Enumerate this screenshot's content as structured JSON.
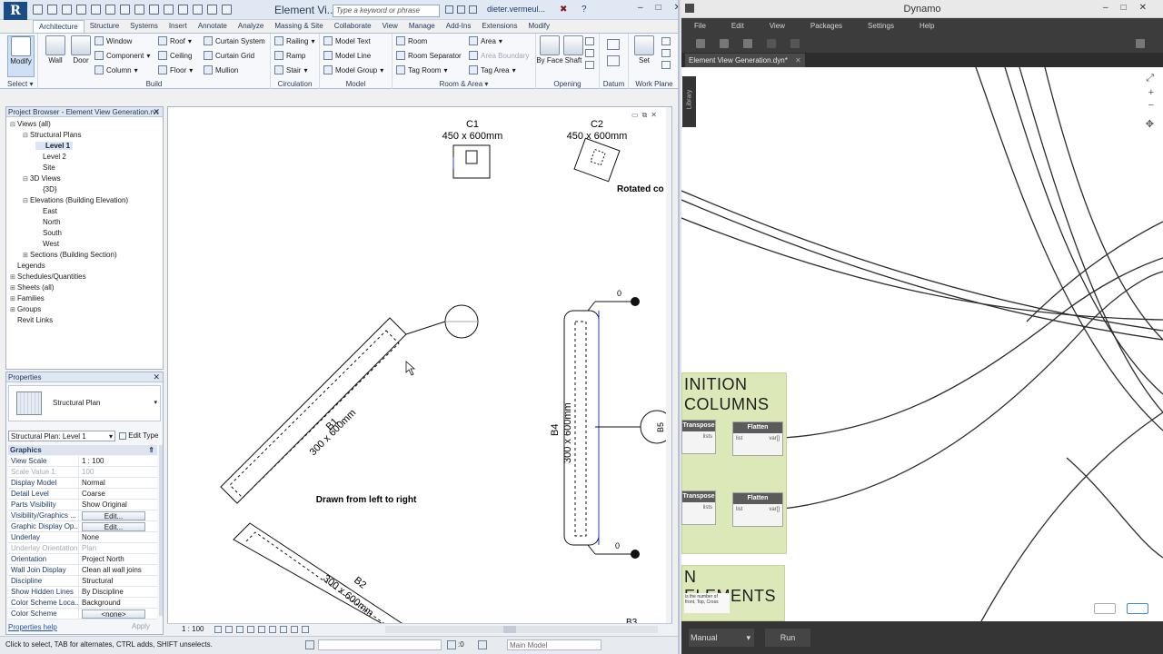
{
  "revit": {
    "title": "Element Vi...",
    "search_placeholder": "Type a keyword or phrase",
    "user": "dieter.vermeul...",
    "window_controls": [
      "–",
      "□",
      "✕"
    ],
    "tabs": [
      "Architecture",
      "Structure",
      "Systems",
      "Insert",
      "Annotate",
      "Analyze",
      "Massing & Site",
      "Collaborate",
      "View",
      "Manage",
      "Add-Ins",
      "Extensions",
      "Modify"
    ],
    "active_tab": "Architecture",
    "ribbon": {
      "modify": "Modify",
      "select": "Select",
      "wall": "Wall",
      "door": "Door",
      "window": "Window",
      "component": "Component",
      "column": "Column",
      "roof": "Roof",
      "ceiling": "Ceiling",
      "floor": "Floor",
      "curtain_system": "Curtain System",
      "curtain_grid": "Curtain Grid",
      "mullion": "Mullion",
      "railing": "Railing",
      "ramp": "Ramp",
      "stair": "Stair",
      "model_text": "Model Text",
      "model_line": "Model Line",
      "model_group": "Model Group",
      "room": "Room",
      "room_separator": "Room Separator",
      "tag_room": "Tag Room",
      "area": "Area",
      "area_boundary": "Area Boundary",
      "tag_area": "Tag Area",
      "by_face": "By Face",
      "shaft": "Shaft",
      "set": "Set",
      "panels": {
        "build": "Build",
        "circulation": "Circulation",
        "model": "Model",
        "room_area": "Room & Area",
        "opening": "Opening",
        "datum": "Datum",
        "work_plane": "Work Plane"
      }
    },
    "project_browser": {
      "title": "Project Browser - Element View Generation.rvt",
      "items": [
        {
          "label": "Views (all)",
          "indent": 0,
          "toggle": "⊟"
        },
        {
          "label": "Structural Plans",
          "indent": 1,
          "toggle": "⊟"
        },
        {
          "label": "Level 1",
          "indent": 2,
          "toggle": "",
          "selected": true
        },
        {
          "label": "Level 2",
          "indent": 2,
          "toggle": ""
        },
        {
          "label": "Site",
          "indent": 2,
          "toggle": ""
        },
        {
          "label": "3D Views",
          "indent": 1,
          "toggle": "⊟"
        },
        {
          "label": "{3D}",
          "indent": 2,
          "toggle": ""
        },
        {
          "label": "Elevations (Building Elevation)",
          "indent": 1,
          "toggle": "⊟"
        },
        {
          "label": "East",
          "indent": 2,
          "toggle": ""
        },
        {
          "label": "North",
          "indent": 2,
          "toggle": ""
        },
        {
          "label": "South",
          "indent": 2,
          "toggle": ""
        },
        {
          "label": "West",
          "indent": 2,
          "toggle": ""
        },
        {
          "label": "Sections (Building Section)",
          "indent": 1,
          "toggle": "⊞"
        },
        {
          "label": "Legends",
          "indent": 0,
          "toggle": ""
        },
        {
          "label": "Schedules/Quantities",
          "indent": 0,
          "toggle": "⊞"
        },
        {
          "label": "Sheets (all)",
          "indent": 0,
          "toggle": "⊞"
        },
        {
          "label": "Families",
          "indent": 0,
          "toggle": "⊞"
        },
        {
          "label": "Groups",
          "indent": 0,
          "toggle": "⊞"
        },
        {
          "label": "Revit Links",
          "indent": 0,
          "toggle": ""
        }
      ]
    },
    "properties": {
      "title": "Properties",
      "type_name": "Structural Plan",
      "instance_selector": "Structural Plan: Level 1",
      "edit_type": "Edit Type",
      "section": "Graphics",
      "rows": [
        {
          "k": "View Scale",
          "v": "1 : 100"
        },
        {
          "k": "Scale Value    1:",
          "v": "100",
          "dim": true
        },
        {
          "k": "Display Model",
          "v": "Normal"
        },
        {
          "k": "Detail Level",
          "v": "Coarse"
        },
        {
          "k": "Parts Visibility",
          "v": "Show Original"
        },
        {
          "k": "Visibility/Graphics ...",
          "v": "Edit...",
          "button": true
        },
        {
          "k": "Graphic Display Op...",
          "v": "Edit...",
          "button": true
        },
        {
          "k": "Underlay",
          "v": "None"
        },
        {
          "k": "Underlay Orientation",
          "v": "Plan",
          "dim": true
        },
        {
          "k": "Orientation",
          "v": "Project North"
        },
        {
          "k": "Wall Join Display",
          "v": "Clean all wall joins"
        },
        {
          "k": "Discipline",
          "v": "Structural"
        },
        {
          "k": "Show Hidden Lines",
          "v": "By Discipline"
        },
        {
          "k": "Color Scheme Loca...",
          "v": "Background"
        },
        {
          "k": "Color Scheme",
          "v": "<none>",
          "button": true
        }
      ],
      "help": "Properties help",
      "apply": "Apply"
    },
    "drawing": {
      "c1_label": "C1",
      "c1_size": "450 x 600mm",
      "c2_label": "C2",
      "c2_size": "450 x 600mm",
      "rotated_note": "Rotated co",
      "b1_label": "B1",
      "b1_size": "300 x 600mm",
      "b2_label": "B2",
      "b2_size": "300 x 600mm",
      "b4_label": "B4",
      "b4_size": "300 x 600mm",
      "b3_label": "B3",
      "b5_label": "B5",
      "note": "Drawn from left to right",
      "elev_top": "0",
      "elev_bottom": "0"
    },
    "view_bar": {
      "scale": "1 : 100"
    },
    "status": {
      "hint": "Click to select, TAB for alternates, CTRL adds, SHIFT unselects.",
      "count": ":0",
      "model": "Main Model"
    }
  },
  "dynamo": {
    "title": "Dynamo",
    "menus": [
      "File",
      "Edit",
      "View",
      "Packages",
      "Settings",
      "Help"
    ],
    "tab": "Element View Generation.dyn*",
    "library": "Library",
    "group1_title_line1": "INITION",
    "group1_title_line2": "COLUMNS",
    "group2_title": "N ELEMENTS",
    "group2_note": "is the number of\nfront, Top, Cross",
    "nodes": [
      {
        "name": "Transpose",
        "port_in": "lists"
      },
      {
        "name": "Flatten",
        "port_in": "list",
        "port_out": "var[]"
      },
      {
        "name": "Transpose",
        "port_in": "lists"
      },
      {
        "name": "Flatten",
        "port_in": "list",
        "port_out": "var[]"
      }
    ],
    "run_mode": "Manual",
    "run": "Run"
  }
}
